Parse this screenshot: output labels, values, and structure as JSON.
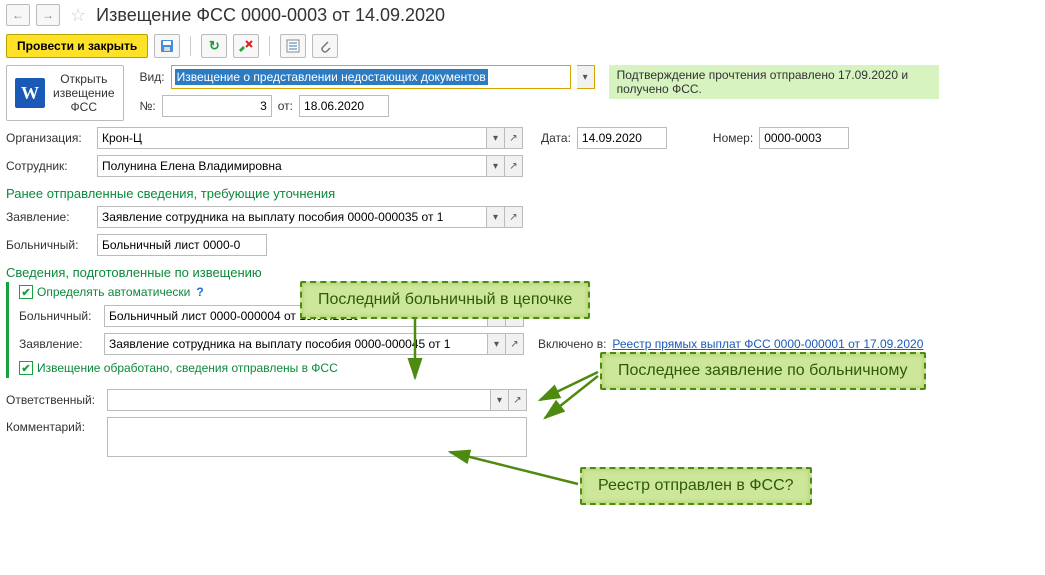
{
  "nav": {
    "back": "←",
    "fwd": "→"
  },
  "title": "Извещение ФСС 0000-0003 от 14.09.2020",
  "toolbar": {
    "post_close": "Провести и закрыть",
    "save_icon": "💾",
    "refresh_icon": "↻",
    "audit_icon": "✎✗",
    "list_icon": "≣",
    "attach_icon": "📎"
  },
  "word_open": {
    "line1": "Открыть",
    "line2": "извещение",
    "line3": "ФСС"
  },
  "vid": {
    "label": "Вид:",
    "value": "Извещение о представлении недостающих документов"
  },
  "confirm": "Подтверждение прочтения отправлено 17.09.2020 и получено ФСС.",
  "num": {
    "label": "№:",
    "value": "3",
    "ot": "от:",
    "date": "18.06.2020"
  },
  "org": {
    "label": "Организация:",
    "value": "Крон-Ц"
  },
  "date": {
    "label": "Дата:",
    "value": "14.09.2020"
  },
  "number": {
    "label": "Номер:",
    "value": "0000-0003"
  },
  "employee": {
    "label": "Сотрудник:",
    "value": "Полунина Елена Владимировна"
  },
  "section1": "Ранее отправленные сведения, требующие уточнения",
  "app1": {
    "label": "Заявление:",
    "value": "Заявление сотрудника на выплату пособия 0000-000035 от 1"
  },
  "sick1": {
    "label": "Больничный:",
    "value": "Больничный лист 0000-0"
  },
  "section2": "Сведения, подготовленные по извещению",
  "auto": {
    "label": "Определять автоматически"
  },
  "sick2": {
    "label": "Больничный:",
    "value": "Больничный лист 0000-000004 от 15.09.2020"
  },
  "app2": {
    "label": "Заявление:",
    "value": "Заявление сотрудника на выплату пособия 0000-000045 от 1"
  },
  "included": {
    "label": "Включено в:",
    "link": "Реестр прямых выплат ФСС 0000-000001 от 17.09.2020"
  },
  "processed": "Извещение обработано, сведения отправлены в ФСС",
  "responsible": {
    "label": "Ответственный:"
  },
  "comment": {
    "label": "Комментарий:"
  },
  "callouts": {
    "c1": "Последний больничный в цепочке",
    "c2": "Последнее заявление по больничному",
    "c3": "Реестр отправлен в ФСС?"
  }
}
